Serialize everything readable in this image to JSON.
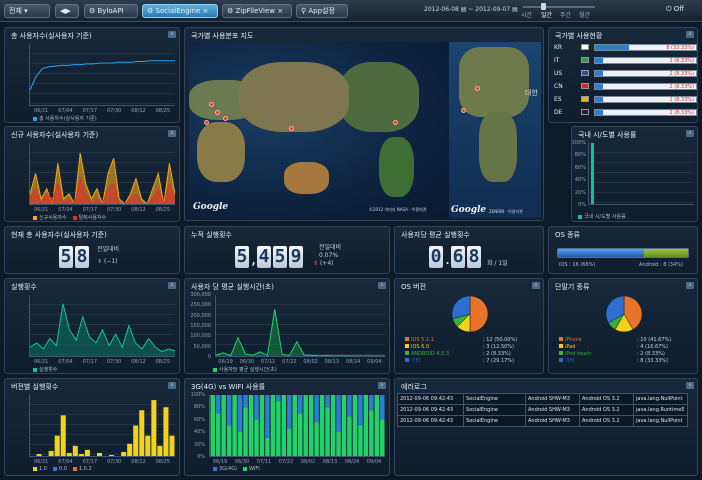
{
  "topbar": {
    "tabs": [
      {
        "label": "전체 ▾",
        "active": false
      },
      {
        "label": "◀▶",
        "active": false
      },
      {
        "label": "⚙ ByloAPI",
        "active": false
      },
      {
        "label": "⚙ SocialEngine ×",
        "active": true
      },
      {
        "label": "⚙ ZipFileView ×",
        "active": false
      },
      {
        "label": "⚲ App설정",
        "active": false
      }
    ],
    "date_range": "2012-06-08 ▤ ~ 2012-09-07 ▤",
    "period": [
      "시간",
      "일간",
      "주간",
      "월간"
    ],
    "period_selected": "일간",
    "power_label": "⏻ Off"
  },
  "panels": {
    "total_users": {
      "title": "총 사용자수(실사용자 기준)",
      "legend": [
        "총 사용자수(실사용자 기준)"
      ]
    },
    "new_users": {
      "title": "신규 사용자수(실사용자 기준)",
      "legend": [
        "신규사용자수",
        "탈퇴사용자수"
      ]
    },
    "map": {
      "title": "국가별 사용분포 지도",
      "google": "Google",
      "copyright": "©2012 이미지 NASA - 이용약관",
      "copyright2": "ZENRIN · 이용약관",
      "china_label": "대한"
    },
    "country": {
      "title": "국가별 사용현황"
    },
    "region": {
      "title": "국내 시/도별 사용률",
      "legend": [
        "국내 시/도별 사용률"
      ]
    },
    "current_users": {
      "title": "현재 총 사용자수(실사용자 기준)",
      "digits": [
        "5",
        "8"
      ],
      "label": "전일대비",
      "delta": "(−1)"
    },
    "cumulative": {
      "title": "누적 실행횟수",
      "digits": [
        "5",
        ",",
        "4",
        "5",
        "9"
      ],
      "label": "전일대비",
      "pct": "0.07%",
      "delta": "(+4)"
    },
    "avg_exec": {
      "title": "사용자당 평균 실행횟수",
      "digits": [
        "0",
        ".",
        "6",
        "8"
      ],
      "unit": "회 / 1일"
    },
    "os_kind": {
      "title": "OS 종류",
      "ios_label": "iOS : 16 (66%)",
      "android_label": "Android : 8 (34%)"
    },
    "executions": {
      "title": "실행횟수",
      "legend": [
        "실행횟수"
      ]
    },
    "avg_time": {
      "title": "사용자 당 평균 실행시간(초)",
      "legend": [
        "사용자당 평균 실행시간(초)"
      ]
    },
    "os_version": {
      "title": "OS 버전"
    },
    "device": {
      "title": "단말기 종류"
    },
    "version_exec": {
      "title": "버전별 실행횟수",
      "legend": [
        "1.0",
        "0.0",
        "1.0.2"
      ]
    },
    "network": {
      "title": "3G(4G) vs WIFI 사용률",
      "legend": [
        "3G(4G)",
        "WIFI"
      ]
    },
    "error_log": {
      "title": "에러로그"
    }
  },
  "countries": [
    {
      "code": "KR",
      "value": "8 (33.33%)",
      "pct": 33.33,
      "flag": "#ffffff"
    },
    {
      "code": "IT",
      "value": "2 (8.33%)",
      "pct": 8.33,
      "flag": "#2a9d4a"
    },
    {
      "code": "US",
      "value": "2 (8.33%)",
      "pct": 8.33,
      "flag": "#3b4aa0"
    },
    {
      "code": "CN",
      "value": "2 (8.33%)",
      "pct": 8.33,
      "flag": "#d62828"
    },
    {
      "code": "ES",
      "value": "2 (8.33%)",
      "pct": 8.33,
      "flag": "#e8b020"
    },
    {
      "code": "DE",
      "value": "2 (8.33%)",
      "pct": 8.33,
      "flag": "#222222"
    }
  ],
  "os_versions": [
    {
      "name": "IOS 5.1.1",
      "value": ": 12 (50.00%)",
      "color": "#e8742a"
    },
    {
      "name": "IOS 6.0",
      "value": ": 3 (12.50%)",
      "color": "#f2d21a"
    },
    {
      "name": "ANDROID 4.0.3",
      "value": ": 2 (8.33%)",
      "color": "#3ab03a"
    },
    {
      "name": "기타",
      "value": ": 7 (29.17%)",
      "color": "#2c6fd0"
    }
  ],
  "devices": [
    {
      "name": "iPhone",
      "value": ": 10 (41.67%)",
      "color": "#e8742a"
    },
    {
      "name": "iPad",
      "value": ": 4 (16.67%)",
      "color": "#f2d21a"
    },
    {
      "name": "iPod touch",
      "value": ": 2 (8.33%)",
      "color": "#3ab03a"
    },
    {
      "name": "기타",
      "value": ": 8 (33.33%)",
      "color": "#2c6fd0"
    }
  ],
  "error_logs": [
    {
      "time": "2012-09-06 09:42:43",
      "app": "SocialEngine",
      "model": "Android SHW-M3",
      "os": "Android OS 3.2",
      "error": "java.lang.NullPoint"
    },
    {
      "time": "2012-09-06 09:42:43",
      "app": "SocialEngine",
      "model": "Android SHW-M3",
      "os": "Android OS 3.2",
      "error": "java.lang.RuntimeE"
    },
    {
      "time": "2012-09-06 09:42:43",
      "app": "SocialEngine",
      "model": "Android SHW-M3",
      "os": "Android OS 3.2",
      "error": "java.lang.NullPoint"
    }
  ],
  "chart_data": [
    {
      "type": "line",
      "title": "총 사용자수(실사용자 기준)",
      "x": [
        "06/21",
        "07/04",
        "07/17",
        "07/30",
        "08/12",
        "08/25"
      ],
      "series": [
        {
          "name": "총 사용자수(실사용자 기준)",
          "values": [
            20,
            38,
            48,
            50,
            51,
            52,
            52,
            53,
            53,
            54,
            54,
            55,
            55,
            55,
            56,
            56,
            56,
            57,
            57,
            58,
            58,
            58,
            58,
            58
          ]
        }
      ],
      "ylim": [
        0,
        80
      ]
    },
    {
      "type": "area",
      "title": "신규 사용자수(실사용자 기준)",
      "x": [
        "06/21",
        "07/04",
        "07/17",
        "07/30",
        "08/12",
        "08/25"
      ],
      "series": [
        {
          "name": "신규사용자수",
          "values": [
            2,
            6,
            1,
            3,
            0,
            8,
            1,
            2,
            0,
            10,
            4,
            1,
            3,
            0,
            6,
            9,
            1,
            0,
            2,
            5,
            1,
            0,
            3,
            6,
            0,
            8,
            2
          ]
        },
        {
          "name": "탈퇴사용자수",
          "values": [
            1,
            3,
            0,
            2,
            1,
            4,
            0,
            1,
            0,
            5,
            2,
            0,
            1,
            0,
            3,
            4,
            0,
            0,
            1,
            2,
            0,
            0,
            1,
            3,
            0,
            4,
            1
          ]
        }
      ]
    },
    {
      "type": "bar",
      "title": "국내 시/도별 사용률",
      "y_ticks": [
        "100%",
        "80%",
        "60%",
        "40%",
        "20%",
        "0%"
      ],
      "values": [
        100
      ]
    },
    {
      "type": "line",
      "title": "실행횟수",
      "x": [
        "06/21",
        "07/04",
        "07/17",
        "07/30",
        "08/12",
        "08/25"
      ],
      "series": [
        {
          "name": "실행횟수",
          "values": [
            10,
            15,
            8,
            20,
            12,
            60,
            30,
            18,
            45,
            22,
            15,
            30,
            12,
            25,
            10,
            35,
            15,
            8,
            20,
            10,
            5,
            8,
            6
          ]
        }
      ]
    },
    {
      "type": "line",
      "title": "사용자 당 평균 실행시간(초)",
      "x": [
        "06/19",
        "06/30",
        "07/11",
        "07/22",
        "08/02",
        "08/13",
        "08/24",
        "09/04"
      ],
      "y_ticks": [
        "300,000",
        "250,000",
        "200,000",
        "150,000",
        "100,000",
        "50,000",
        "0"
      ],
      "series": [
        {
          "name": "사용자당 평균 실행시간(초)",
          "values": [
            5000,
            15000,
            2000,
            90000,
            10000,
            4000,
            20000,
            3000,
            230000,
            8000,
            2000,
            70000,
            5000,
            3000,
            1000,
            2000,
            500,
            1000,
            800,
            400,
            200,
            500,
            300,
            100
          ]
        }
      ],
      "ylim": [
        0,
        300000
      ]
    },
    {
      "type": "pie",
      "title": "OS 버전",
      "values": [
        50.0,
        12.5,
        8.33,
        29.17
      ]
    },
    {
      "type": "pie",
      "title": "단말기 종류",
      "values": [
        41.67,
        16.67,
        8.33,
        33.33
      ]
    },
    {
      "type": "bar",
      "title": "버전별 실행횟수",
      "x": [
        "06/21",
        "07/04",
        "07/17",
        "07/30",
        "08/12",
        "08/25"
      ],
      "series": [
        {
          "name": "1.0",
          "values": [
            0,
            2,
            0,
            5,
            20,
            40,
            3,
            10,
            2,
            6,
            0,
            3,
            0,
            1,
            0,
            4,
            12,
            30,
            45,
            20,
            55,
            10,
            48,
            20
          ]
        },
        {
          "name": "0.0",
          "values": [
            0,
            0,
            0,
            0,
            0,
            0,
            0,
            0,
            0,
            0,
            0,
            0,
            0,
            0,
            0,
            0,
            0,
            0,
            0,
            0,
            0,
            0,
            0,
            0
          ]
        },
        {
          "name": "1.0.2",
          "values": [
            0,
            0,
            0,
            0,
            0,
            0,
            0,
            0,
            0,
            0,
            0,
            0,
            0,
            0,
            0,
            0,
            0,
            0,
            0,
            0,
            0,
            0,
            0,
            0
          ]
        }
      ]
    },
    {
      "type": "bar",
      "title": "3G(4G) vs WIFI 사용률",
      "x": [
        "06/19",
        "06/30",
        "07/11",
        "07/22",
        "08/02",
        "08/13",
        "08/24",
        "09/04"
      ],
      "y_ticks": [
        "100%",
        "80%",
        "60%",
        "40%",
        "20%",
        "0%"
      ],
      "series": [
        {
          "name": "3G(4G)",
          "values": [
            0,
            30,
            0,
            50,
            0,
            60,
            20,
            0,
            40,
            0,
            70,
            0,
            10,
            0,
            55,
            0,
            30,
            0,
            0,
            45,
            0,
            20,
            0,
            60,
            0,
            35,
            0,
            50,
            0,
            25,
            0,
            40
          ]
        },
        {
          "name": "WIFI",
          "values": [
            100,
            70,
            100,
            50,
            100,
            40,
            80,
            100,
            60,
            100,
            30,
            100,
            90,
            100,
            45,
            100,
            70,
            100,
            100,
            55,
            100,
            80,
            100,
            40,
            100,
            65,
            100,
            50,
            100,
            75,
            100,
            60
          ]
        }
      ],
      "ylim": [
        0,
        100
      ]
    }
  ]
}
